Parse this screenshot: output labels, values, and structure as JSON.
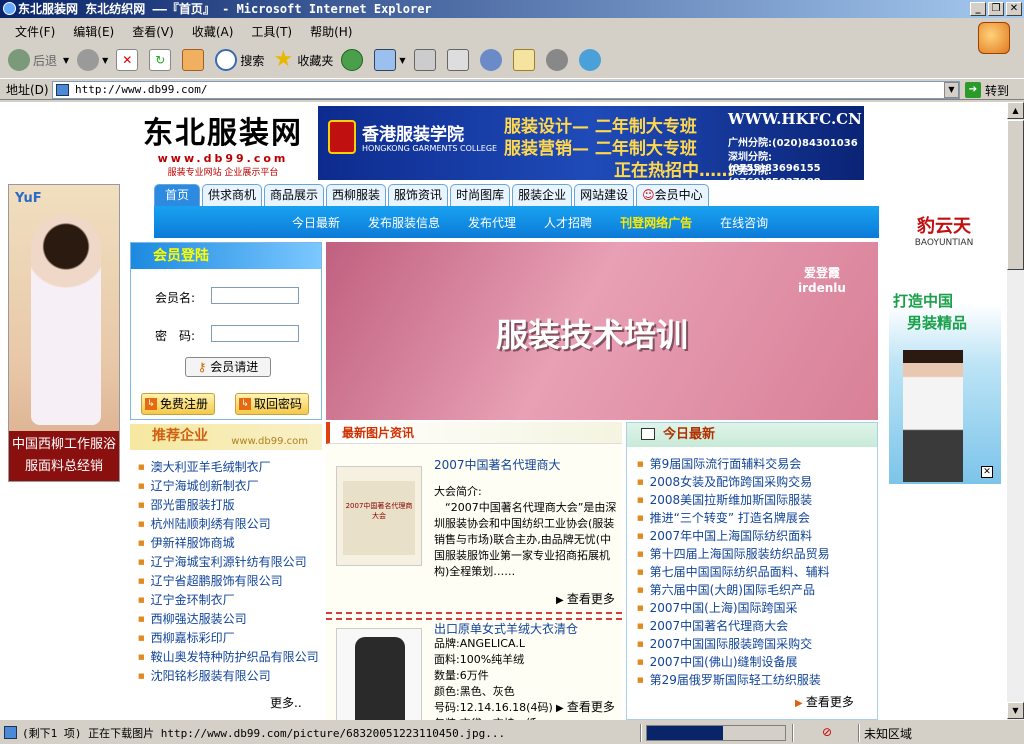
{
  "window": {
    "title": "东北服装网 东北纺织网 ——『首页』 - Microsoft Internet Explorer"
  },
  "menu": [
    "文件(F)",
    "编辑(E)",
    "查看(V)",
    "收藏(A)",
    "工具(T)",
    "帮助(H)"
  ],
  "toolbar": {
    "back": "后退",
    "search": "搜索",
    "favorites": "收藏夹"
  },
  "address": {
    "label": "地址(D)",
    "url": "http://www.db99.com/",
    "go": "转到"
  },
  "status": {
    "text": "(剩下1 项) 正在下载图片 http://www.db99.com/picture/68320051223110450.jpg...",
    "zone": "未知区域",
    "progress": 0.55
  },
  "site": {
    "logo_text": "东北服装网",
    "logo_url": "www.db99.com",
    "logo_slogan": "服装专业网站 企业展示平台"
  },
  "banner": {
    "school": "香港服装学院",
    "school_en": "HONGKONG GARMENTS COLLEGE",
    "line1": "服装设计— 二年制大专班",
    "line2": "服装营销— 二年制大专班",
    "hot": "正在热招中……",
    "site": "WWW.HKFC.CN",
    "phones": [
      "广州分院:(020)84301036",
      "深圳分院:(0755)83696155",
      "东莞分院:(0769)85027988"
    ]
  },
  "nav": [
    "首页",
    "供求商机",
    "商品展示",
    "西柳服装",
    "服饰资讯",
    "时尚图库",
    "服装企业",
    "网站建设",
    "会员中心"
  ],
  "subnav": [
    "今日最新",
    "发布服装信息",
    "发布代理",
    "人才招聘",
    "刊登网络广告",
    "在线咨询"
  ],
  "left_ad": {
    "brand": "YuF",
    "caption": "中国西柳工作服浴服面料总经销"
  },
  "right_ad": {
    "brand": "豹云天",
    "brand_en": "BAOYUNTIAN",
    "slogan1": "打造中国",
    "slogan2": "男装精品"
  },
  "login": {
    "title": "会员登陆",
    "user_label": "会员名:",
    "pass_label": "密　码:",
    "enter": "会员请进",
    "register": "免费注册",
    "recover": "取回密码"
  },
  "recommend": {
    "title": "推荐企业",
    "site": "www.db99.com",
    "items": [
      "澳大利亚羊毛绒制衣厂",
      "辽宁海城创新制衣厂",
      "邵光雷服装打版",
      "杭州陆顺刺绣有限公司",
      "伊新祥服饰商城",
      "辽宁海城宝利源针纺有限公司",
      "辽宁省超鹏服饰有限公司",
      "辽宁金环制衣厂",
      "西柳强达服装公司",
      "西柳嘉标彩印厂",
      "鞍山奥发特种防护织品有限公司",
      "沈阳铭杉服装有限公司"
    ],
    "more": "更多.."
  },
  "main_banner": {
    "title": "服装技术培训",
    "brand": "爱登霞",
    "brand_en": "irdenlu"
  },
  "news": {
    "title": "最新图片资讯",
    "items": [
      {
        "title": "2007中国著名代理商大",
        "body": "大会简介:\n　“2007中国著名代理商大会”是由深圳服装协会和中国纺织工业协会(服装销售与市场)联合主办,由品牌无忧(中国服装服饰业第一家专业招商拓展机构)全程策划……",
        "more": "查看更多",
        "thumb": "2007中国著名代理商大会"
      },
      {
        "title": "出口原单女式羊绒大衣清仓",
        "body": "品牌:ANGELICA.L\n面料:100%纯羊绒\n数量:6万件\n颜色:黑色、灰色\n号码:12.14.16.18(4码)\n包装:衣袋、衣挂、纸……",
        "more": "查看更多"
      }
    ]
  },
  "today": {
    "title": "今日最新",
    "items": [
      "第9届国际流行面辅料交易会",
      "2008女装及配饰跨国采购交易",
      "2008美国拉斯维加斯国际服装",
      "推进“三个转变” 打造名牌展会",
      "2007年中国上海国际纺织面料",
      "第十四届上海国际服装纺织品贸易",
      "第七届中国国际纺织品面料、辅料",
      "第六届中国(大朗)国际毛织产品",
      "2007中国(上海)国际跨国采",
      "2007中国著名代理商大会",
      "2007中国国际服装跨国采购交",
      "2007中国(佛山)缝制设备展",
      "第29届俄罗斯国际轻工纺织服装"
    ],
    "more": "查看更多"
  },
  "colors": {
    "accent": "#2c8ae0",
    "titlebar": "#0a246a",
    "link": "#114499"
  }
}
